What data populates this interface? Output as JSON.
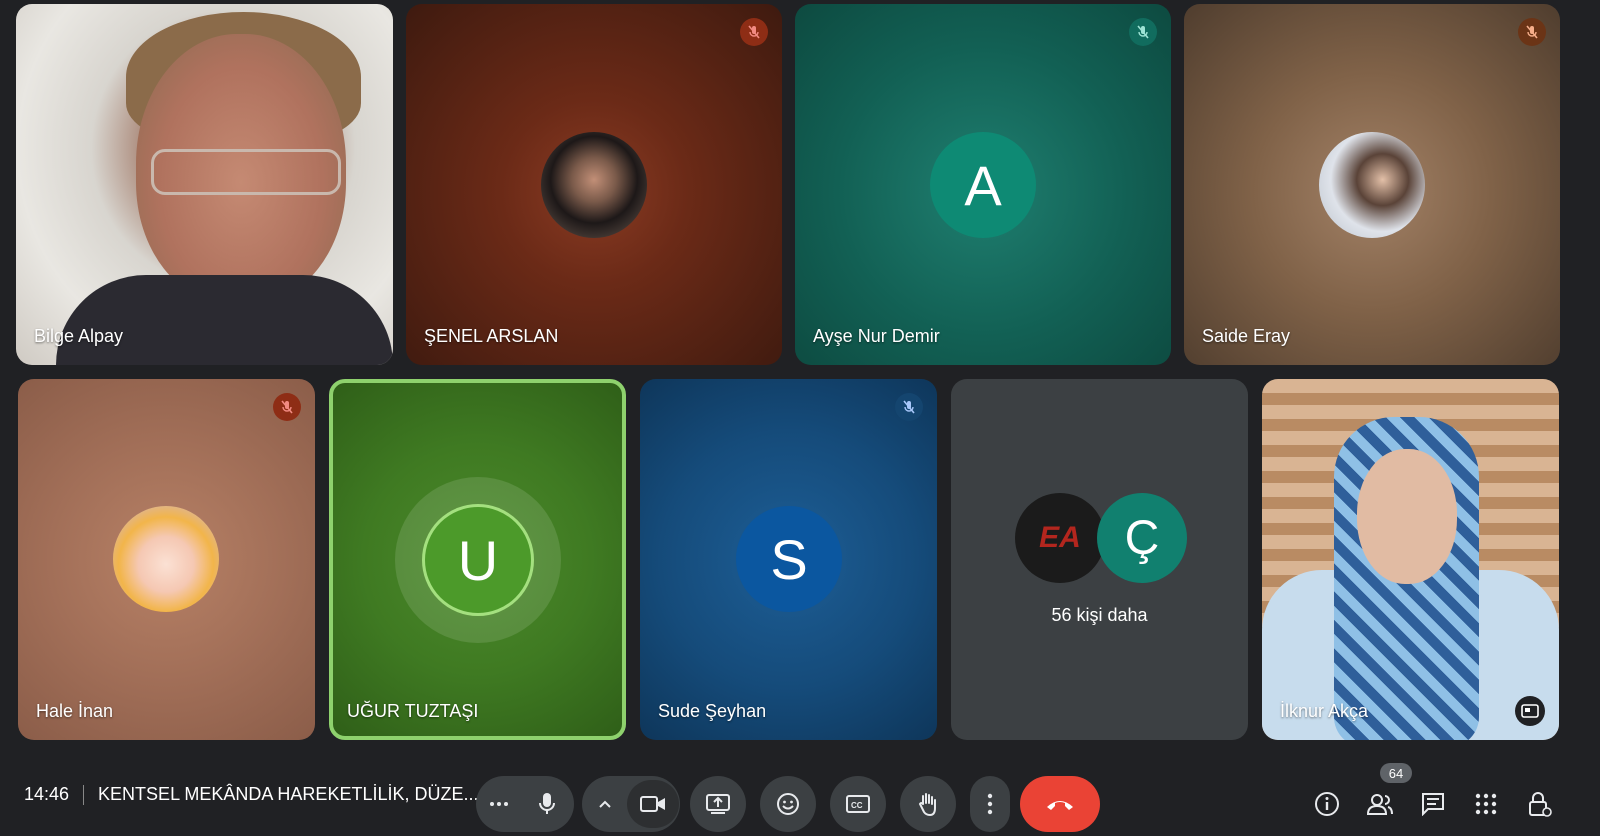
{
  "participants": {
    "bilge": {
      "name": "Bilge Alpay"
    },
    "senel": {
      "name": "ŞENEL ARSLAN"
    },
    "ayse": {
      "name": "Ayşe Nur Demir",
      "initial": "A"
    },
    "saide": {
      "name": "Saide Eray"
    },
    "hale": {
      "name": "Hale İnan"
    },
    "ugur": {
      "name": "UĞUR TUZTAŞI",
      "initial": "U"
    },
    "sude": {
      "name": "Sude Şeyhan",
      "initial": "S"
    },
    "more": {
      "label": "56 kişi daha",
      "avatar_initial": "Ç",
      "logo_text": "EA"
    },
    "ilknur": {
      "name": "İlknur Akça"
    }
  },
  "meeting": {
    "time": "14:46",
    "title": "KENTSEL MEKÂNDA HAREKETLİLİK, DÜZE..."
  },
  "controls": {
    "participant_count": "64"
  },
  "colors": {
    "active_speaker": "#8ed16d",
    "end_call": "#ea4335",
    "mute_red": "#9a2a1a",
    "mute_teal": "#116c5e"
  }
}
